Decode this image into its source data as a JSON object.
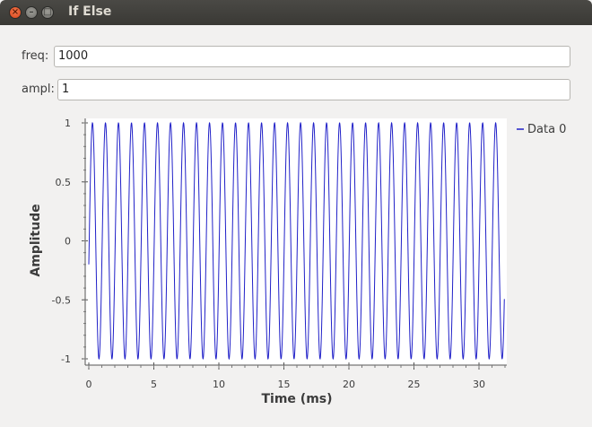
{
  "window": {
    "title": "If Else"
  },
  "controls": {
    "freq": {
      "label": "freq:",
      "value": "1000"
    },
    "ampl": {
      "label": "ampl:",
      "value": "1"
    }
  },
  "colors": {
    "trace": "#2020c8",
    "accent_close": "#e0521f"
  },
  "chart_data": {
    "type": "line",
    "title": "",
    "xlabel": "Time (ms)",
    "ylabel": "Amplitude",
    "xlim": [
      0,
      32
    ],
    "ylim": [
      -1,
      1
    ],
    "xticks": [
      0,
      5,
      10,
      15,
      20,
      25,
      30
    ],
    "yticks": [
      -1,
      -0.5,
      0,
      0.5,
      1
    ],
    "ytick_labels": [
      "-1",
      "-0.5",
      "0",
      "0.5",
      "1"
    ],
    "legend_position": "top-right",
    "series": [
      {
        "name": "Data 0",
        "frequency_khz": 1,
        "amplitude": 1,
        "phase_offset": -0.2,
        "x_start": 0,
        "x_end": 31.95
      }
    ]
  }
}
